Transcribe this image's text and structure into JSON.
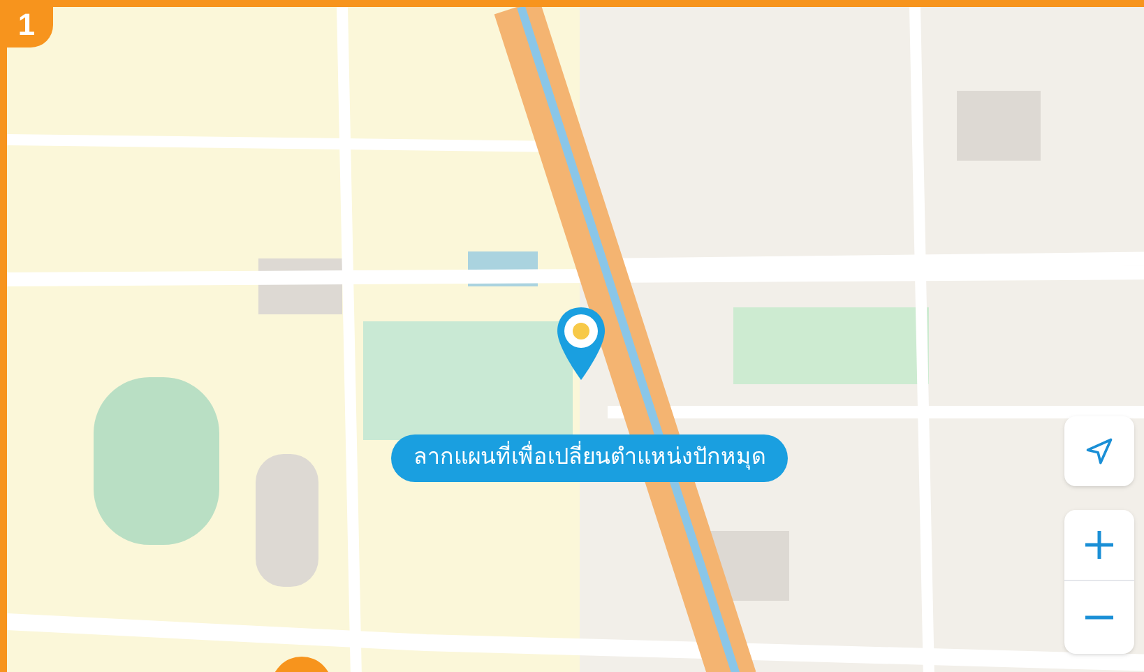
{
  "step_badge": "1",
  "map": {
    "pin_hint": "ลากแผนที่เพื่อเปลี่ยนตำแหน่งปักหมุด"
  }
}
